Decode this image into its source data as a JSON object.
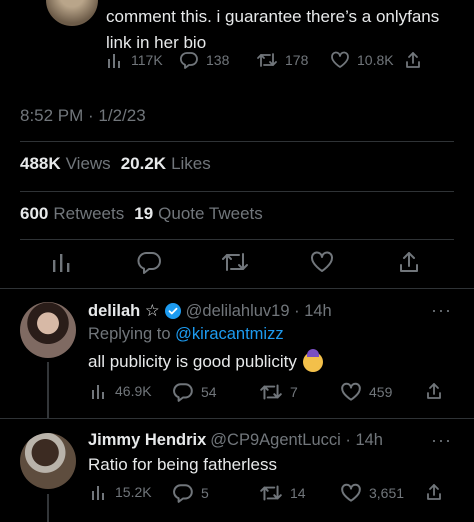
{
  "top_tweet": {
    "text": "comment this. i guarantee there’s a onlyfans link in her bio",
    "views": "117K",
    "replies": "138",
    "retweets": "178",
    "likes": "10.8K"
  },
  "main_tweet": {
    "timestamp": "8:52 PM · 1/2/23",
    "views_count": "488K",
    "views_label": "Views",
    "likes_count": "20.2K",
    "likes_label": "Likes",
    "retweets_count": "600",
    "retweets_label": "Retweets",
    "quotes_count": "19",
    "quotes_label": "Quote Tweets"
  },
  "replies": [
    {
      "name": "delilah ☆",
      "handle": "@delilahluv19 · 14h",
      "replying_prefix": "Replying to",
      "replying_to": "@kiracantmizz",
      "text": "all publicity is good publicity",
      "views": "46.9K",
      "replies": "54",
      "retweets": "7",
      "likes": "459"
    },
    {
      "name": "Jimmy Hendrix",
      "handle": "@CP9AgentLucci · 14h",
      "text": "Ratio for being fatherless",
      "views": "15.2K",
      "replies": "5",
      "retweets": "14",
      "likes": "3,651"
    }
  ],
  "icons": {
    "views": "bar-chart-icon",
    "reply": "comment-icon",
    "retweet": "retweet-icon",
    "like": "heart-icon",
    "share": "share-icon",
    "verified": "verified-badge-icon",
    "more": "more-icon"
  },
  "colors": {
    "background": "#000000",
    "text": "#e7e9ea",
    "muted": "#71767b",
    "link": "#1d9bf0",
    "divider": "#2f3336"
  },
  "more_glyph": "···"
}
